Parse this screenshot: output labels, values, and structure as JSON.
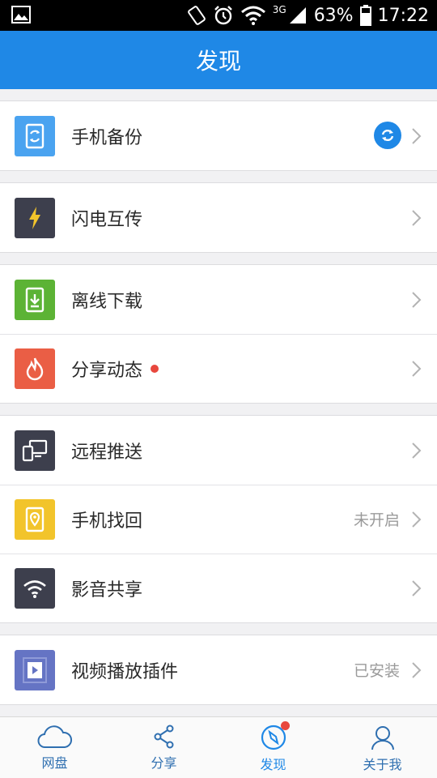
{
  "status_bar": {
    "network": "3G",
    "battery": "63%",
    "time": "17:22"
  },
  "header": {
    "title": "发现"
  },
  "groups": [
    {
      "items": [
        {
          "label": "手机备份",
          "icon": "phone-backup-icon",
          "color": "#4aa3f0",
          "status": "",
          "sync_badge": true
        }
      ]
    },
    {
      "items": [
        {
          "label": "闪电互传",
          "icon": "lightning-icon",
          "color": "#3d3f4d",
          "status": ""
        }
      ]
    },
    {
      "items": [
        {
          "label": "离线下载",
          "icon": "download-icon",
          "color": "#5cb335",
          "status": ""
        },
        {
          "label": "分享动态",
          "icon": "flame-icon",
          "color": "#ea5e45",
          "status": "",
          "dot": true
        }
      ]
    },
    {
      "items": [
        {
          "label": "远程推送",
          "icon": "devices-icon",
          "color": "#3d3f4d",
          "status": ""
        },
        {
          "label": "手机找回",
          "icon": "location-phone-icon",
          "color": "#f2c42b",
          "status": "未开启"
        },
        {
          "label": "影音共享",
          "icon": "wifi-icon",
          "color": "#3d3f4d",
          "status": ""
        }
      ]
    },
    {
      "items": [
        {
          "label": "视频播放插件",
          "icon": "video-play-icon",
          "color": "#6574c4",
          "status": "已安装"
        }
      ]
    }
  ],
  "tabbar": {
    "tabs": [
      {
        "label": "网盘",
        "icon": "cloud-icon"
      },
      {
        "label": "分享",
        "icon": "share-icon"
      },
      {
        "label": "发现",
        "icon": "compass-icon",
        "active": true,
        "badge": true
      },
      {
        "label": "关于我",
        "icon": "person-icon"
      }
    ]
  },
  "colors": {
    "accent": "#1f88e6",
    "badge_red": "#e8473d"
  }
}
